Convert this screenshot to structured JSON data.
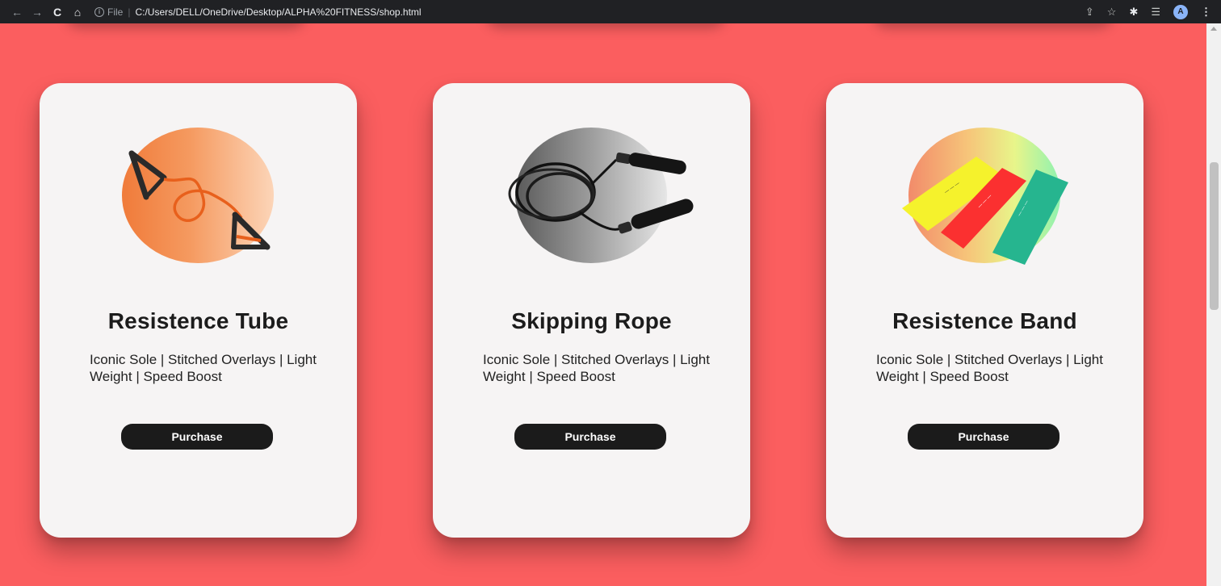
{
  "browser": {
    "back_icon": "←",
    "forward_icon": "→",
    "reload_icon": "C",
    "home_icon": "⌂",
    "info_glyph": "i",
    "url_scheme_label": "File",
    "url_separator": "|",
    "url": "C:/Users/DELL/OneDrive/Desktop/ALPHA%20FITNESS/shop.html",
    "share_icon": "⇪",
    "star_icon": "☆",
    "extensions_icon": "✱",
    "reading_list_icon": "☰",
    "avatar_letter": "A",
    "menu_icon": "⋮"
  },
  "colors": {
    "page_background": "#fb5e5f",
    "card_background": "#f6f4f4",
    "button_background": "#1b1b1b"
  },
  "products": [
    {
      "name": "Resistence Tube",
      "description": "Iconic Sole | Stitched Overlays | Light Weight | Speed Boost",
      "button_label": "Purchase",
      "image_icon": "resistance-tube-icon"
    },
    {
      "name": "Skipping Rope",
      "description": "Iconic Sole | Stitched Overlays | Light Weight | Speed Boost",
      "button_label": "Purchase",
      "image_icon": "skipping-rope-icon"
    },
    {
      "name": "Resistence Band",
      "description": "Iconic Sole | Stitched Overlays | Light Weight | Speed Boost",
      "button_label": "Purchase",
      "image_icon": "resistance-band-icon"
    }
  ]
}
